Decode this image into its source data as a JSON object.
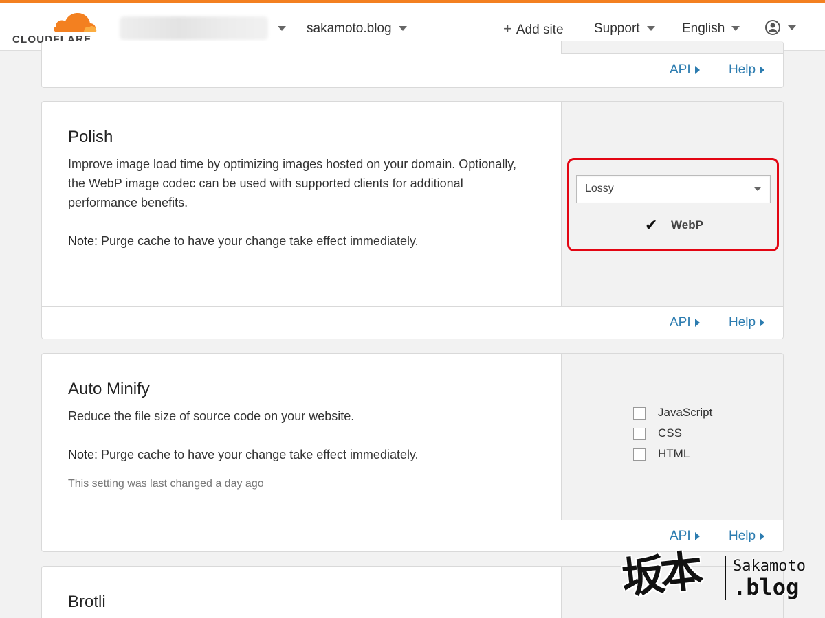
{
  "header": {
    "brand": "CLOUDFLARE",
    "site": "sakamoto.blog",
    "add_site": "Add site",
    "support": "Support",
    "language": "English"
  },
  "cards": {
    "top": {
      "api": "API",
      "help": "Help"
    },
    "polish": {
      "title": "Polish",
      "desc": "Improve image load time by optimizing images hosted on your domain. Optionally, the WebP image codec can be used with supported clients for additional performance benefits.",
      "note_label": "Note",
      "note_text": ": Purge cache to have your change take effect immediately.",
      "select_value": "Lossy",
      "webp_label": "WebP",
      "webp_checked": true,
      "api": "API",
      "help": "Help"
    },
    "minify": {
      "title": "Auto Minify",
      "desc": "Reduce the file size of source code on your website.",
      "note_label": "Note:",
      "note_text": " Purge cache to have your change take effect immediately.",
      "last_changed": "This setting was last changed a day ago",
      "options": [
        "JavaScript",
        "CSS",
        "HTML"
      ],
      "api": "API",
      "help": "Help"
    },
    "brotli": {
      "title": "Brotli"
    }
  },
  "watermark": {
    "kanji": "坂本",
    "name": "Sakamoto",
    "tld": ".blog"
  },
  "colors": {
    "accent": "#f38020",
    "link": "#2c7cb0",
    "highlight": "#e30613"
  }
}
